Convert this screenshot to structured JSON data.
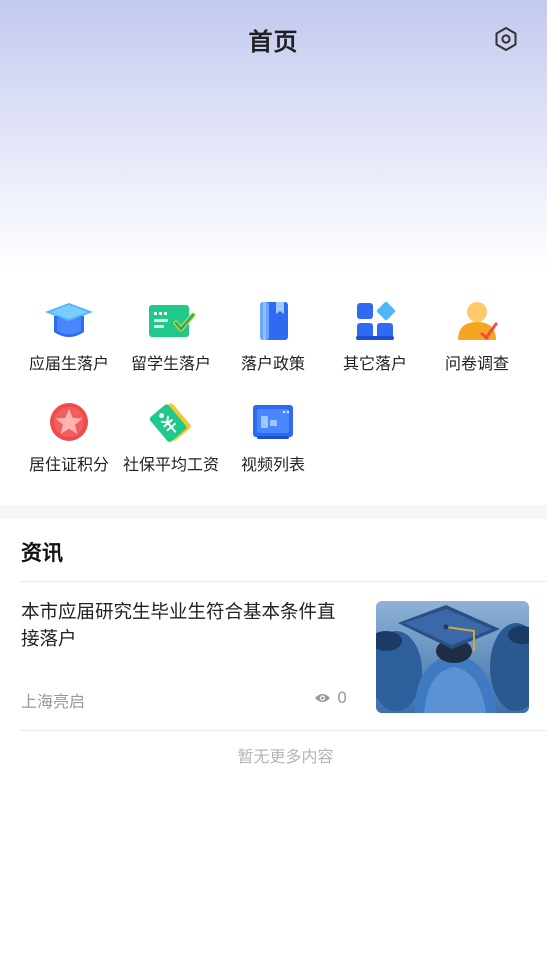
{
  "header": {
    "title": "首页"
  },
  "grid": {
    "items": [
      {
        "label": "应届生落户",
        "icon": "graduation-cap-icon"
      },
      {
        "label": "留学生落户",
        "icon": "certificate-check-icon"
      },
      {
        "label": "落户政策",
        "icon": "policy-book-icon"
      },
      {
        "label": "其它落户",
        "icon": "app-blocks-icon"
      },
      {
        "label": "问卷调查",
        "icon": "survey-person-icon"
      },
      {
        "label": "居住证积分",
        "icon": "star-badge-icon"
      },
      {
        "label": "社保平均工资",
        "icon": "price-tag-icon"
      },
      {
        "label": "视频列表",
        "icon": "video-screen-icon"
      }
    ]
  },
  "news_section": {
    "title": "资讯",
    "items": [
      {
        "title": "本市应届研究生毕业生符合基本条件直接落户",
        "source": "上海亮启",
        "views": "0"
      }
    ],
    "empty_text": "暂无更多内容"
  },
  "colors": {
    "primary_blue": "#2f6bf2",
    "green": "#1fc98a",
    "orange": "#f7a521",
    "red": "#ef4b4b"
  }
}
